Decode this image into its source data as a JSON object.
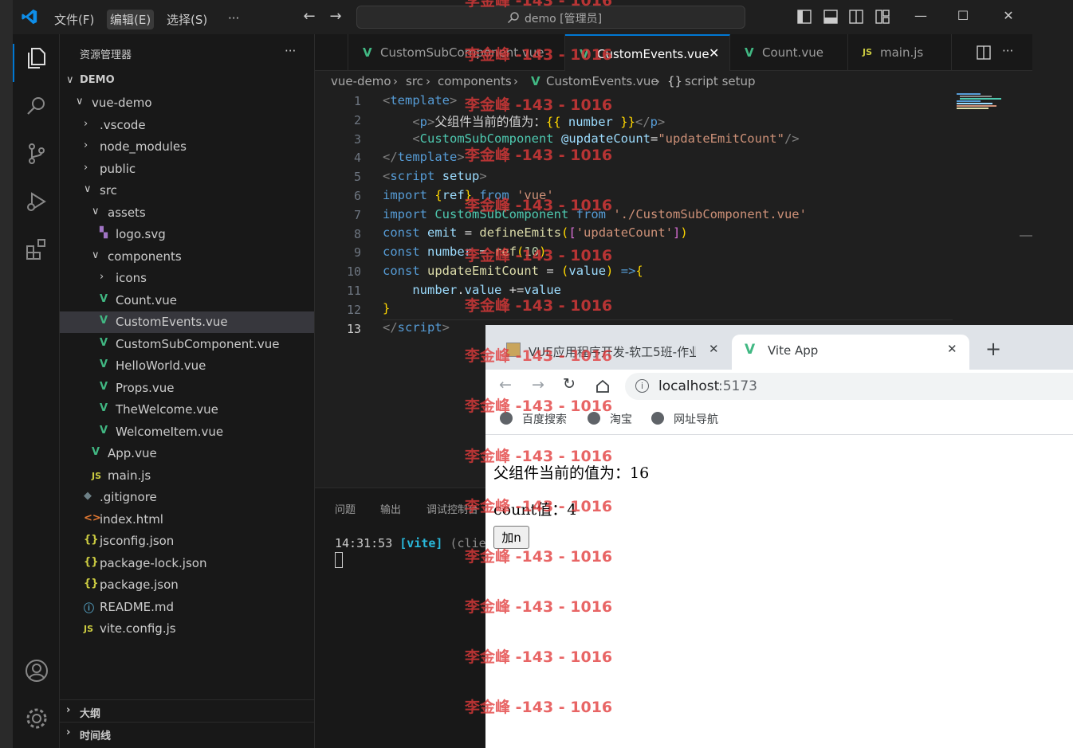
{
  "titlebar": {
    "menus": [
      "文件(F)",
      "编辑(E)",
      "选择(S)",
      "···"
    ],
    "command_center": "demo [管理员]"
  },
  "explorer": {
    "header": "资源管理器",
    "more": "···",
    "root": "DEMO",
    "items": [
      {
        "label": "vue-demo",
        "kind": "folder-open"
      },
      {
        "label": ".vscode",
        "kind": "folder"
      },
      {
        "label": "node_modules",
        "kind": "folder"
      },
      {
        "label": "public",
        "kind": "folder"
      },
      {
        "label": "src",
        "kind": "folder-open"
      },
      {
        "label": "assets",
        "kind": "folder-open"
      },
      {
        "label": "logo.svg",
        "kind": "svg"
      },
      {
        "label": "components",
        "kind": "folder-open"
      },
      {
        "label": "icons",
        "kind": "folder"
      },
      {
        "label": "Count.vue",
        "kind": "vue"
      },
      {
        "label": "CustomEvents.vue",
        "kind": "vue"
      },
      {
        "label": "CustomSubComponent.vue",
        "kind": "vue"
      },
      {
        "label": "HelloWorld.vue",
        "kind": "vue"
      },
      {
        "label": "Props.vue",
        "kind": "vue"
      },
      {
        "label": "TheWelcome.vue",
        "kind": "vue"
      },
      {
        "label": "WelcomeItem.vue",
        "kind": "vue"
      },
      {
        "label": "App.vue",
        "kind": "vue"
      },
      {
        "label": "main.js",
        "kind": "js"
      },
      {
        "label": ".gitignore",
        "kind": "git"
      },
      {
        "label": "index.html",
        "kind": "html"
      },
      {
        "label": "jsconfig.json",
        "kind": "json"
      },
      {
        "label": "package-lock.json",
        "kind": "json"
      },
      {
        "label": "package.json",
        "kind": "json"
      },
      {
        "label": "README.md",
        "kind": "info"
      },
      {
        "label": "vite.config.js",
        "kind": "js"
      }
    ],
    "outline": "大纲",
    "timeline": "时间线"
  },
  "tabs": [
    {
      "label": "CustomSubComponent.vue",
      "icon": "V"
    },
    {
      "label": "CustomEvents.vue",
      "icon": "V",
      "active": true
    },
    {
      "label": "Count.vue",
      "icon": "V"
    },
    {
      "label": "main.js",
      "icon": "JS"
    }
  ],
  "breadcrumb": [
    "vue-demo",
    "src",
    "components",
    "CustomEvents.vue",
    "script setup"
  ],
  "code_line_numbers": [
    "1",
    "2",
    "3",
    "4",
    "5",
    "6",
    "7",
    "8",
    "9",
    "10",
    "11",
    "12",
    "13"
  ],
  "panel": {
    "tabs": [
      "问题",
      "输出",
      "调试控制台"
    ],
    "terminal_time": "14:31:53",
    "terminal_tag": "[vite]",
    "terminal_rest": "(clie"
  },
  "browser": {
    "tabs": [
      {
        "label": "VUE应用程序开发-软工5班-作业"
      },
      {
        "label": "Vite App",
        "active": true
      }
    ],
    "new_tab": "+",
    "url_host": "localhost",
    "url_port": ":5173",
    "bookmarks": [
      "百度搜索",
      "淘宝",
      "网址导航"
    ],
    "page": {
      "parent_value": "父组件当前的值为：16",
      "count_value": "count值：4",
      "add_button": "加n"
    }
  },
  "watermark": "李金峰 -143 - 1016"
}
